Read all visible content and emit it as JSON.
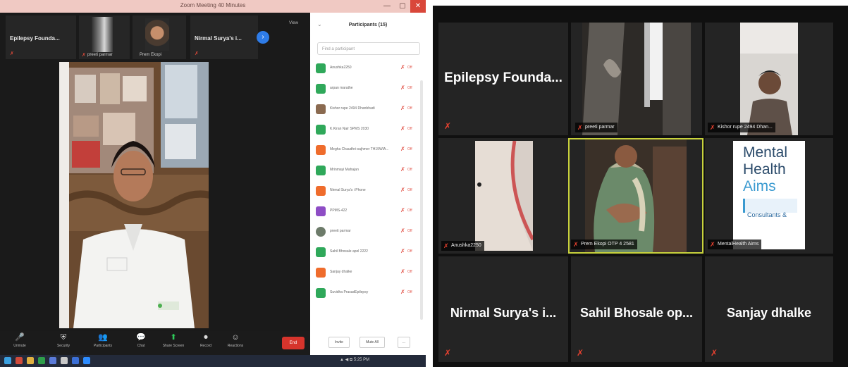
{
  "left": {
    "window": {
      "title": "Zoom Meeting 40 Minutes",
      "minimize": "—",
      "maximize": "▢",
      "close": "✕"
    },
    "thumbnails": [
      {
        "name": "Epilepsy Founda...",
        "sub": ""
      },
      {
        "name": "",
        "sub": "preeti parmar"
      },
      {
        "name": "",
        "sub": "Prem Ekopi"
      },
      {
        "name": "Nirmal Surya's i...",
        "sub": ""
      }
    ],
    "view_label": "View",
    "panel": {
      "title": "Participants (15)",
      "search_placeholder": "Find a participant",
      "participants": [
        {
          "name": "Anushka2250",
          "color": "#2fa85a"
        },
        {
          "name": "arpan marathe",
          "color": "#2fa85a"
        },
        {
          "name": "Kishor rupe 2494 Dhanbhadi",
          "color": "#8a6a50"
        },
        {
          "name": "K.Kiran Nair SPMS 2030",
          "color": "#2fa85a"
        },
        {
          "name": "Megha Chaudhri-sajhmer TH19WIA...",
          "color": "#ef6c2c"
        },
        {
          "name": "Mrinmayi Mahajan",
          "color": "#2fa85a"
        },
        {
          "name": "Nirmal Surya's i Phone",
          "color": "#ef6c2c"
        },
        {
          "name": "PPMS-422",
          "color": "#8e4dc5"
        },
        {
          "name": "preeti parmar",
          "color": "#6d7b6a"
        },
        {
          "name": "Sahil Bhosale apol 2222",
          "color": "#2fa85a"
        },
        {
          "name": "Sanjay dhalke",
          "color": "#ef6c2c"
        },
        {
          "name": "Suvidha PrasadEpilepsy",
          "color": "#2fa85a"
        }
      ],
      "invite_label": "Invite",
      "mute_all_label": "Mute All",
      "more_label": "..."
    },
    "toolbar": {
      "items": [
        {
          "label": "Unmute",
          "icon": "🎤"
        },
        {
          "label": "Security",
          "icon": "⛨"
        },
        {
          "label": "Participants",
          "icon": "👥"
        },
        {
          "label": "Chat",
          "icon": "💬"
        },
        {
          "label": "Share Screen",
          "icon": "⬆"
        },
        {
          "label": "Record",
          "icon": "⏺"
        },
        {
          "label": "Reactions",
          "icon": "☺"
        }
      ],
      "end_label": "End"
    },
    "tray_time": "▲ ◀ ⧉ 5:25 PM"
  },
  "right": {
    "tiles": [
      {
        "name": "Epilepsy  Founda...",
        "label": ""
      },
      {
        "name": "",
        "label": "preeti parmar"
      },
      {
        "name": "",
        "label": "Kishor rupe 2494 Dhan..."
      },
      {
        "name": "",
        "label": "Anushka2250"
      },
      {
        "name": "",
        "label": "Prem Ekopi OTP 4 2581"
      },
      {
        "name": "",
        "label": "MentalHealth Aims"
      },
      {
        "name": "Nirmal Surya's i...",
        "label": ""
      },
      {
        "name": "Sahil Bhosale op...",
        "label": ""
      },
      {
        "name": "Sanjay dhalke",
        "label": ""
      }
    ],
    "poster": {
      "line1": "Mental",
      "line2": "Health",
      "line3": "Aims",
      "line4": "Consultants &"
    }
  }
}
